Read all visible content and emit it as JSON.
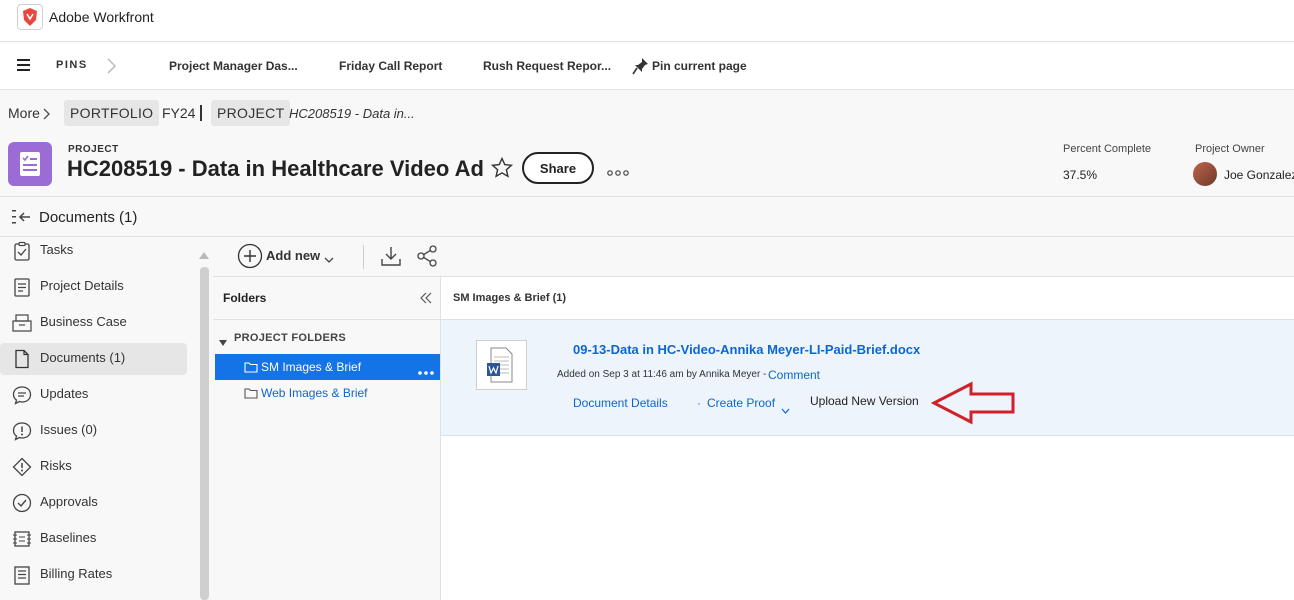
{
  "app": {
    "title": "Adobe Workfront"
  },
  "pins": {
    "label": "PINS",
    "items": [
      "Project Manager Das...",
      "Friday Call Report",
      "Rush Request Repor..."
    ],
    "pin_current": "Pin current page"
  },
  "breadcrumb": {
    "more": "More",
    "portfolio": "PORTFOLIO",
    "portfolio_name": "FY24",
    "project": "PROJECT",
    "project_name": "HC208519 - Data in..."
  },
  "project": {
    "label": "PROJECT",
    "title": "HC208519 - Data in Healthcare Video Ad",
    "share": "Share",
    "percent_complete_label": "Percent Complete",
    "percent_complete_value": "37.5%",
    "owner_label": "Project Owner",
    "owner_name": "Joe Gonzalez"
  },
  "section": {
    "title": "Documents (1)"
  },
  "nav": {
    "items": [
      {
        "label": "Tasks",
        "icon": "tasks-icon"
      },
      {
        "label": "Project Details",
        "icon": "details-icon"
      },
      {
        "label": "Business Case",
        "icon": "business-case-icon"
      },
      {
        "label": "Documents (1)",
        "icon": "document-icon",
        "active": true
      },
      {
        "label": "Updates",
        "icon": "updates-icon"
      },
      {
        "label": "Issues (0)",
        "icon": "issues-icon"
      },
      {
        "label": "Risks",
        "icon": "risks-icon"
      },
      {
        "label": "Approvals",
        "icon": "approvals-icon"
      },
      {
        "label": "Baselines",
        "icon": "baselines-icon"
      },
      {
        "label": "Billing Rates",
        "icon": "billing-rates-icon"
      }
    ]
  },
  "toolbar": {
    "add_new": "Add new"
  },
  "folders": {
    "title": "Folders",
    "group": "PROJECT FOLDERS",
    "items": [
      {
        "label": "SM Images & Brief",
        "selected": true
      },
      {
        "label": "Web Images & Brief",
        "selected": false
      }
    ]
  },
  "docs": {
    "header": "SM Images & Brief (1)",
    "document": {
      "name": "09-13-Data in HC-Video-Annika Meyer-LI-Paid-Brief.docx",
      "added": "Added on Sep 3 at 11:46 am by Annika Meyer -",
      "comment": "Comment",
      "details": "Document Details",
      "create_proof": "Create Proof",
      "upload_version": "Upload New Version"
    }
  },
  "colors": {
    "accent": "#1473e6",
    "project_icon": "#9b6bd6",
    "annotation_arrow": "#d0202a",
    "link": "#0d66d0"
  }
}
